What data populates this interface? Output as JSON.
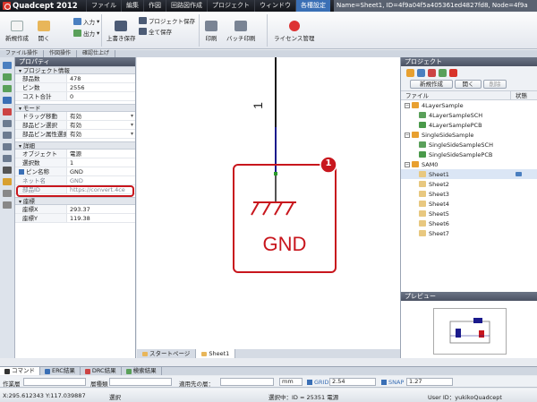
{
  "app": {
    "title": "Quadcept 2012",
    "window_info": "Name=Sheet1, ID=4f9a04f5a405361ed4827fd8, Node=4f9a"
  },
  "menu": [
    "ファイル",
    "編集",
    "作図",
    "回路図作成",
    "プロジェクト",
    "ウィンドウ",
    "各種設定"
  ],
  "ribbon": {
    "new": "新規作成",
    "open": "開く",
    "input": "入力",
    "output": "出力",
    "overwrite_save": "上書き保存",
    "project_save": "プロジェクト保存",
    "save_all": "全て保存",
    "print": "印刷",
    "batch_print": "バッチ印刷",
    "license": "ライセンス管理"
  },
  "group_tabs": [
    "ファイル操作",
    "作図操作",
    "確認仕上げ"
  ],
  "properties": {
    "header": "プロパティ",
    "project_info": {
      "title": "プロジェクト情報",
      "rows": [
        {
          "k": "部品数",
          "v": "478"
        },
        {
          "k": "ピン数",
          "v": "2556"
        },
        {
          "k": "コスト合計",
          "v": "0"
        }
      ]
    },
    "mode": {
      "title": "モード",
      "rows": [
        {
          "k": "ドラッグ移動",
          "v": "有効"
        },
        {
          "k": "部品ピン選択",
          "v": "有効"
        },
        {
          "k": "部品ピン属性選択",
          "v": "有効"
        }
      ]
    },
    "detail": {
      "title": "詳細",
      "rows": [
        {
          "k": "オブジェクト",
          "v": "電源"
        },
        {
          "k": "選択数",
          "v": "1"
        },
        {
          "k": "ピン名称",
          "v": "GND"
        },
        {
          "k": "ネット名",
          "v": "GND"
        },
        {
          "k": "部品ID",
          "v": "https://convert.4ce"
        }
      ]
    },
    "coords": {
      "title": "座標",
      "rows": [
        {
          "k": "座標X",
          "v": "293.37"
        },
        {
          "k": "座標Y",
          "v": "119.38"
        }
      ]
    }
  },
  "canvas": {
    "symbol_label": "GND",
    "callout_number": "1",
    "pin_label": "1"
  },
  "canvas_tabs": [
    "スタートページ",
    "Sheet1"
  ],
  "project": {
    "header": "プロジェクト",
    "new_button": "新規作成",
    "open_button": "開く",
    "remove_button": "削除",
    "col_file": "ファイル",
    "col_state": "状態",
    "tree": [
      {
        "label": "4LayerSample",
        "level": 0,
        "type": "project"
      },
      {
        "label": "4LayerSampleSCH",
        "level": 1,
        "type": "sch"
      },
      {
        "label": "4LayerSamplePCB",
        "level": 1,
        "type": "pcb"
      },
      {
        "label": "SingleSideSample",
        "level": 0,
        "type": "project"
      },
      {
        "label": "SingleSideSampleSCH",
        "level": 1,
        "type": "sch"
      },
      {
        "label": "SingleSideSamplePCB",
        "level": 1,
        "type": "pcb"
      },
      {
        "label": "SAM0",
        "level": 0,
        "type": "project"
      },
      {
        "label": "Sheet1",
        "level": 1,
        "type": "sheet",
        "selected": true
      },
      {
        "label": "Sheet2",
        "level": 1,
        "type": "sheet"
      },
      {
        "label": "Sheet3",
        "level": 1,
        "type": "sheet"
      },
      {
        "label": "Sheet4",
        "level": 1,
        "type": "sheet"
      },
      {
        "label": "Sheet5",
        "level": 1,
        "type": "sheet"
      },
      {
        "label": "Sheet6",
        "level": 1,
        "type": "sheet"
      },
      {
        "label": "Sheet7",
        "level": 1,
        "type": "sheet"
      }
    ],
    "preview_header": "プレビュー"
  },
  "bottom_tabs": [
    "コマンド",
    "ERC結果",
    "DRC結果",
    "検索結果"
  ],
  "cmdbar": {
    "work_layer": "作業層",
    "layer_type": "層種類",
    "applied_layer": "適用先の層：",
    "unit": "mm",
    "grid_label": "GRID",
    "grid_value": "2.54",
    "snap_label": "SNAP",
    "snap_value": "1.27"
  },
  "status": {
    "coords": "X:295.612343 Y:117.039887",
    "mode": "選択",
    "selection": "選択中：ID = 25351 電源",
    "user": "User ID：yukikoQuadcept"
  },
  "colors": {
    "accent": "#3a6fb5",
    "highlight": "#c8161d",
    "wire": "#1a1a8c"
  }
}
